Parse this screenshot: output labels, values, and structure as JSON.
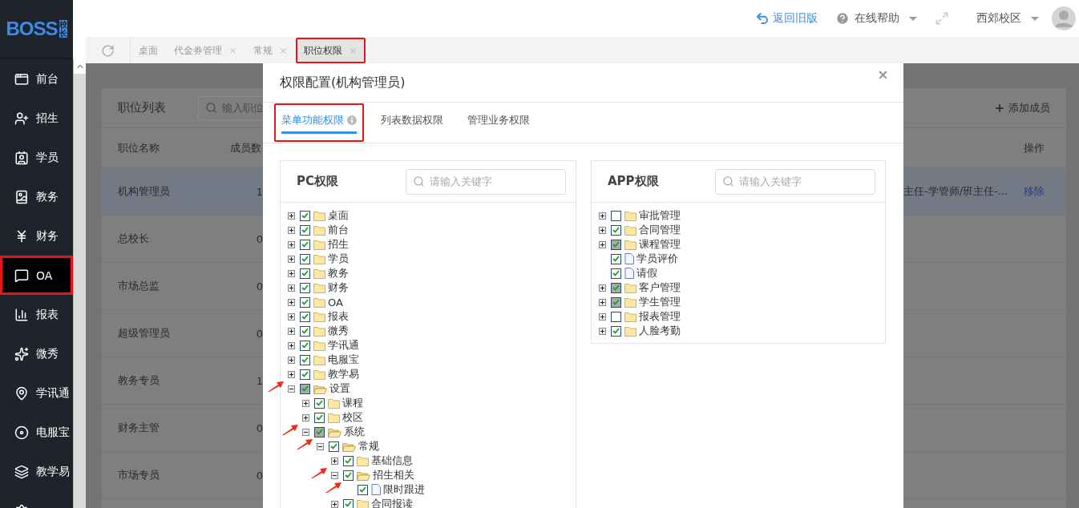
{
  "sidebar": {
    "logo": {
      "text": "BOSS",
      "badge": "校长"
    },
    "items": [
      {
        "label": "前台",
        "selected": false,
        "annotated": false
      },
      {
        "label": "招生",
        "selected": false,
        "annotated": false
      },
      {
        "label": "学员",
        "selected": false,
        "annotated": false
      },
      {
        "label": "教务",
        "selected": false,
        "annotated": false
      },
      {
        "label": "财务",
        "selected": false,
        "annotated": false
      },
      {
        "label": "OA",
        "selected": true,
        "annotated": true
      },
      {
        "label": "报表",
        "selected": false,
        "annotated": false
      },
      {
        "label": "微秀",
        "selected": false,
        "annotated": false
      },
      {
        "label": "学讯通",
        "selected": false,
        "annotated": false
      },
      {
        "label": "电服宝",
        "selected": false,
        "annotated": false
      },
      {
        "label": "教学易",
        "selected": false,
        "annotated": false
      },
      {
        "selected": false,
        "annotated": false
      }
    ]
  },
  "header": {
    "back_link": "返回旧版",
    "help": "在线帮助",
    "campus": "西郊校区"
  },
  "tab_bar": {
    "tabs": [
      {
        "label": "桌面",
        "closable": false,
        "selected": false,
        "annotated": false
      },
      {
        "label": "代金券管理",
        "closable": true,
        "selected": false,
        "annotated": false
      },
      {
        "label": "常规",
        "closable": true,
        "selected": false,
        "annotated": false
      },
      {
        "label": "职位权限",
        "closable": true,
        "selected": true,
        "annotated": true
      }
    ]
  },
  "position_list": {
    "title": "职位列表",
    "search": {
      "placeholder": "输入职位"
    },
    "add_button": "添加成员",
    "columns": [
      "职位名称",
      "成员数",
      "操作"
    ],
    "rows": [
      {
        "name": "机构管理员",
        "count": "1",
        "column_3": "主任-学管师/班主任-...",
        "action": "移除",
        "selected": true
      },
      {
        "name": "总校长",
        "count": "0",
        "selected": false
      },
      {
        "name": "市场总监",
        "count": "0",
        "selected": false
      },
      {
        "name": "超级管理员",
        "count": "0",
        "selected": false
      },
      {
        "name": "教务专员",
        "count": "1",
        "selected": false
      },
      {
        "name": "财务主管",
        "count": "0",
        "selected": false
      },
      {
        "name": "市场专员",
        "count": "0",
        "selected": false
      }
    ]
  },
  "modal": {
    "title": "权限配置(机构管理员)",
    "tabs": [
      {
        "label": "菜单功能权限",
        "info": true,
        "selected": true,
        "annotated": true
      },
      {
        "label": "列表数据权限",
        "info": false,
        "selected": false,
        "annotated": false
      },
      {
        "label": "管理业务权限",
        "info": false,
        "selected": false,
        "annotated": false
      }
    ],
    "panels": [
      {
        "title": "PC权限",
        "search": {
          "placeholder": "请输入关键字"
        },
        "tree": [
          {
            "label": "桌面",
            "kind": "folder",
            "checked": true,
            "partial": false,
            "expanded": false,
            "annotated": false
          },
          {
            "label": "前台",
            "kind": "folder",
            "checked": true,
            "partial": false,
            "expanded": false,
            "annotated": false
          },
          {
            "label": "招生",
            "kind": "folder",
            "checked": true,
            "partial": false,
            "expanded": false,
            "annotated": false
          },
          {
            "label": "学员",
            "kind": "folder",
            "checked": true,
            "partial": false,
            "expanded": false,
            "annotated": false
          },
          {
            "label": "教务",
            "kind": "folder",
            "checked": true,
            "partial": false,
            "expanded": false,
            "annotated": false
          },
          {
            "label": "财务",
            "kind": "folder",
            "checked": true,
            "partial": false,
            "expanded": false,
            "annotated": false
          },
          {
            "label": "OA",
            "kind": "folder",
            "checked": true,
            "partial": false,
            "expanded": false,
            "annotated": false
          },
          {
            "label": "报表",
            "kind": "folder",
            "checked": true,
            "partial": false,
            "expanded": false,
            "annotated": false
          },
          {
            "label": "微秀",
            "kind": "folder",
            "checked": true,
            "partial": false,
            "expanded": false,
            "annotated": false
          },
          {
            "label": "学讯通",
            "kind": "folder",
            "checked": true,
            "partial": false,
            "expanded": false,
            "annotated": false
          },
          {
            "label": "电服宝",
            "kind": "folder",
            "checked": true,
            "partial": false,
            "expanded": false,
            "annotated": false
          },
          {
            "label": "教学易",
            "kind": "folder",
            "checked": true,
            "partial": false,
            "expanded": false,
            "annotated": false
          },
          {
            "label": "设置",
            "kind": "folder",
            "checked": true,
            "partial": true,
            "expanded": true,
            "annotated": true,
            "children": [
              {
                "label": "课程",
                "kind": "folder",
                "checked": true,
                "partial": false,
                "expanded": false,
                "annotated": false
              },
              {
                "label": "校区",
                "kind": "folder",
                "checked": true,
                "partial": false,
                "expanded": false,
                "annotated": false
              },
              {
                "label": "系统",
                "kind": "folder",
                "checked": true,
                "partial": true,
                "expanded": true,
                "annotated": true,
                "children": [
                  {
                    "label": "常规",
                    "kind": "folder",
                    "checked": true,
                    "partial": false,
                    "expanded": true,
                    "annotated": true,
                    "children": [
                      {
                        "label": "基础信息",
                        "kind": "folder",
                        "checked": true,
                        "partial": false,
                        "expanded": false,
                        "annotated": false
                      },
                      {
                        "label": "招生相关",
                        "kind": "folder",
                        "checked": true,
                        "partial": false,
                        "expanded": true,
                        "annotated": true,
                        "children": [
                          {
                            "label": "限时跟进",
                            "kind": "file",
                            "checked": true,
                            "partial": false,
                            "annotated": true
                          }
                        ]
                      },
                      {
                        "label": "合同报读",
                        "kind": "folder",
                        "checked": true,
                        "partial": false,
                        "expanded": false,
                        "annotated": false
                      }
                    ]
                  }
                ]
              }
            ]
          }
        ]
      },
      {
        "title": "APP权限",
        "search": {
          "placeholder": "请输入关键字"
        },
        "tree": [
          {
            "label": "审批管理",
            "kind": "folder",
            "checked": false,
            "partial": false,
            "expanded": false,
            "annotated": false
          },
          {
            "label": "合同管理",
            "kind": "folder",
            "checked": true,
            "partial": false,
            "expanded": false,
            "annotated": false
          },
          {
            "label": "课程管理",
            "kind": "folder",
            "checked": true,
            "partial": true,
            "expanded": false,
            "annotated": false
          },
          {
            "label": "学员评价",
            "kind": "file",
            "checked": true,
            "partial": false,
            "annotated": false
          },
          {
            "label": "请假",
            "kind": "file",
            "checked": true,
            "partial": false,
            "annotated": false
          },
          {
            "label": "客户管理",
            "kind": "folder",
            "checked": true,
            "partial": true,
            "expanded": false,
            "annotated": false
          },
          {
            "label": "学生管理",
            "kind": "folder",
            "checked": true,
            "partial": true,
            "expanded": false,
            "annotated": false
          },
          {
            "label": "报表管理",
            "kind": "folder",
            "checked": false,
            "partial": false,
            "expanded": false,
            "annotated": false
          },
          {
            "label": "人脸考勤",
            "kind": "folder",
            "checked": true,
            "partial": false,
            "expanded": false,
            "annotated": false
          }
        ]
      }
    ]
  }
}
